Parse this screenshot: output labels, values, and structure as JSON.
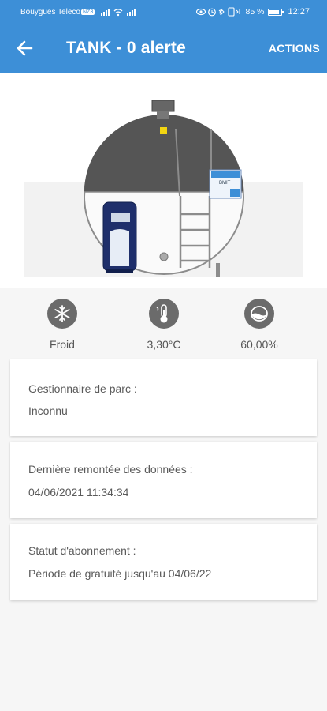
{
  "status_bar": {
    "carrier": "Bouygues Teleco",
    "carrier_badge": "NZ3",
    "battery_pct": "85 %",
    "time": "12:27"
  },
  "header": {
    "title": "TANK - 0 alerte",
    "actions_label": "ACTIONS"
  },
  "tank_illustration": {
    "panel_label": "BMIT",
    "colors": {
      "header_bg": "#3d8fd7",
      "tank_top": "#555555",
      "device": "#1f2f6b"
    }
  },
  "metrics": [
    {
      "icon": "snowflake-icon",
      "value": "Froid"
    },
    {
      "icon": "thermometer-icon",
      "value": "3,30°C"
    },
    {
      "icon": "tank-level-icon",
      "value": "60,00%"
    }
  ],
  "cards": [
    {
      "label": "Gestionnaire de parc :",
      "value": "Inconnu"
    },
    {
      "label": "Dernière remontée des données :",
      "value": "04/06/2021 11:34:34"
    },
    {
      "label": "Statut d'abonnement :",
      "value": "Période de gratuité jusqu'au 04/06/22"
    }
  ]
}
